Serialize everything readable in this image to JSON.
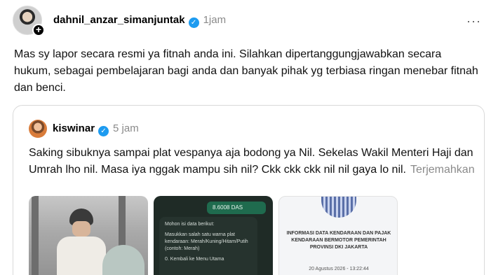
{
  "post": {
    "username": "dahnil_anzar_simanjuntak",
    "time": "1jam",
    "more": "···",
    "text": "Mas sy lapor secara resmi ya fitnah anda ini. Silahkan dipertanggungjawabkan secara hukum, sebagai pembelajaran bagi anda dan banyak pihak yg terbiasa ringan menebar fitnah dan benci.",
    "verified_icon": "verified-badge-icon",
    "add_icon": "+"
  },
  "quote": {
    "username": "kiswinar",
    "time": "5 jam",
    "text": "Saking sibuknya sampai plat vespanya aja bodong ya Nil. Sekelas Wakil Menteri Haji dan Umrah lho nil. Masa iya nggak mampu sih nil? Ckk ckk ckk nil nil gaya lo nil.",
    "translate_label": "Terjemahkan"
  },
  "media": {
    "chat": {
      "top": "8.6008 DAS",
      "lines": [
        "Mohon isi data berikut:",
        "Masukkan salah satu warna plat kendaraan: Merah/Kuning/Hitam/Putih (contoh: Merah)",
        "0. Kembali ke Menu Utama"
      ]
    },
    "document": {
      "title": "INFORMASI DATA KENDARAAN DAN PAJAK KENDARAAN BERMOTOR PEMERINTAH PROVINSI DKI JAKARTA",
      "date": "20 Agustus 2026 - 13:22:44"
    }
  },
  "colors": {
    "verified": "#1d9bf0",
    "muted_text": "#8a8a8a"
  }
}
